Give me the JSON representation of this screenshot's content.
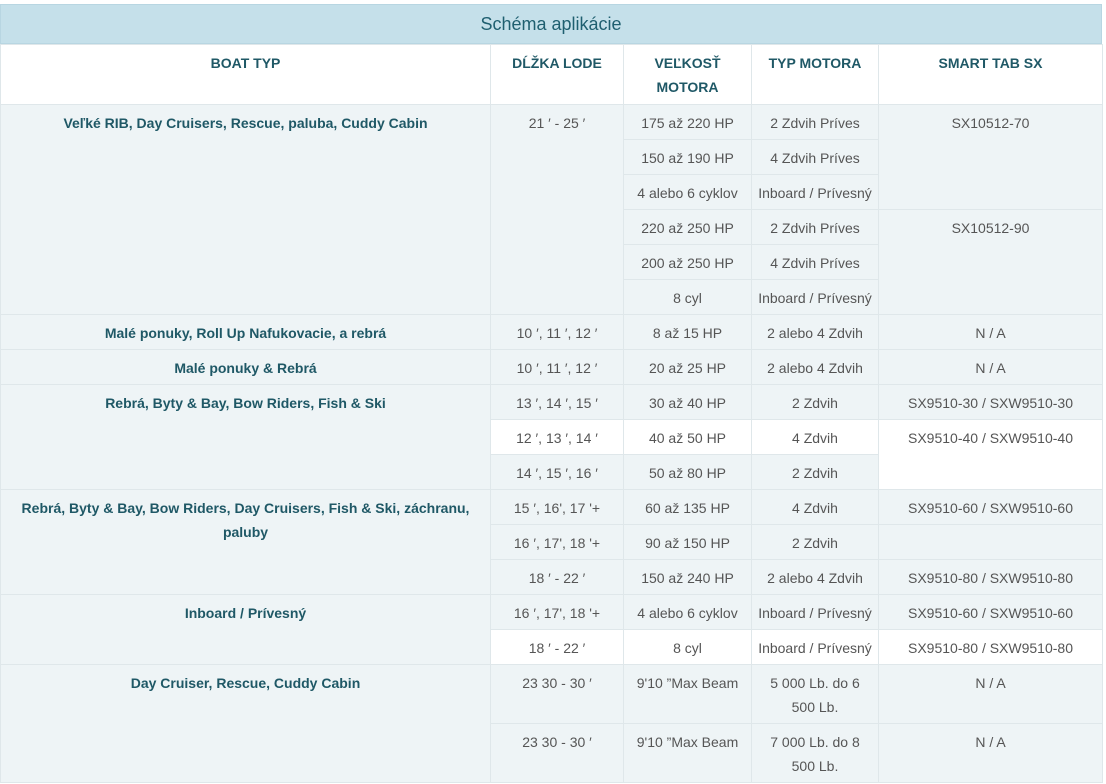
{
  "title": "Schéma aplikácie",
  "headers": {
    "boat_typ": "BOAT TYP",
    "dlzka_lode": "DĹŽKA LODE",
    "velkost_motora": "VEĽKOSŤ MOTORA",
    "typ_motora": "TYP MOTORA",
    "smart_tab": "SMART TAB SX"
  },
  "groups": {
    "g1": {
      "boat": "Veľké RIB, Day Cruisers, Rescue, paluba, Cuddy Cabin",
      "length": "21 ′ - 25 ′",
      "r1": {
        "size": "175 až 220 HP",
        "motor": "2 Zdvih Príves"
      },
      "r2": {
        "size": "150 až 190 HP",
        "motor": "4 Zdvih Príves"
      },
      "r3": {
        "size": "4 alebo 6 cyklov",
        "motor": "Inboard / Prívesný"
      },
      "r4": {
        "size": "220 až 250 HP",
        "motor": "2 Zdvih Príves"
      },
      "r5": {
        "size": "200 až 250 HP",
        "motor": "4 Zdvih Príves"
      },
      "r6": {
        "size": "8 cyl",
        "motor": "Inboard / Prívesný"
      },
      "smart_a": "SX10512-70",
      "smart_b": "SX10512-90"
    },
    "g2": {
      "boat": "Malé ponuky, Roll Up Nafukovacie, a rebrá",
      "length": "10 ′, 11 ′, 12 ′",
      "size": "8 až 15 HP",
      "motor": "2 alebo 4 Zdvih",
      "smart": "N / A"
    },
    "g3": {
      "boat": "Malé ponuky & Rebrá",
      "length": "10 ′, 11 ′, 12 ′",
      "size": "20 až 25 HP",
      "motor": "2 alebo 4 Zdvih",
      "smart": "N / A"
    },
    "g4": {
      "boat": "Rebrá, Byty & Bay, Bow Riders, Fish & Ski",
      "r1": {
        "length": "13 ′, 14 ′, 15 ′",
        "size": "30 až 40 HP",
        "motor": "2 Zdvih",
        "smart": "SX9510-30 / SXW9510-30"
      },
      "r2": {
        "length": "12 ′, 13 ′, 14 ′",
        "size": "40 až 50 HP",
        "motor": "4 Zdvih",
        "smart": "SX9510-40 / SXW9510-40"
      },
      "r3": {
        "length": "14 ′, 15 ′, 16 ′",
        "size": "50 až 80 HP",
        "motor": "2 Zdvih"
      }
    },
    "g5": {
      "boat": "Rebrá, Byty & Bay, Bow Riders, Day Cruisers, Fish & Ski, záchranu, paluby",
      "r1": {
        "length": "15 ′, 16', 17 '+",
        "size": "60 až 135 HP",
        "motor": "4 Zdvih",
        "smart": "SX9510-60 / SXW9510-60"
      },
      "r2": {
        "length": "16 ′, 17', 18 '+",
        "size": "90 až 150 HP",
        "motor": "2 Zdvih",
        "smart": ""
      },
      "r3": {
        "length": "18 ′ - 22 ′",
        "size": "150 až 240 HP",
        "motor": "2 alebo 4 Zdvih",
        "smart": "SX9510-80 / SXW9510-80"
      }
    },
    "g6": {
      "boat": "Inboard / Prívesný",
      "r1": {
        "length": "16 ′, 17', 18 '+",
        "size": "4 alebo 6 cyklov",
        "motor": "Inboard / Prívesný",
        "smart": "SX9510-60 / SXW9510-60"
      },
      "r2": {
        "length": "18 ′ - 22 ′",
        "size": "8 cyl",
        "motor": "Inboard / Prívesný",
        "smart": "SX9510-80 / SXW9510-80"
      }
    },
    "g7": {
      "boat": "Day Cruiser, Rescue, Cuddy Cabin",
      "r1": {
        "length": "23 30 - 30 ′",
        "size": "9'10 ”Max Beam",
        "motor": "5 000 Lb. do 6 500 Lb.",
        "smart": "N / A"
      },
      "r2": {
        "length": "23 30 - 30 ′",
        "size": "9'10 ”Max Beam",
        "motor": "7 000 Lb. do 8 500 Lb.",
        "smart": "N / A"
      }
    }
  }
}
